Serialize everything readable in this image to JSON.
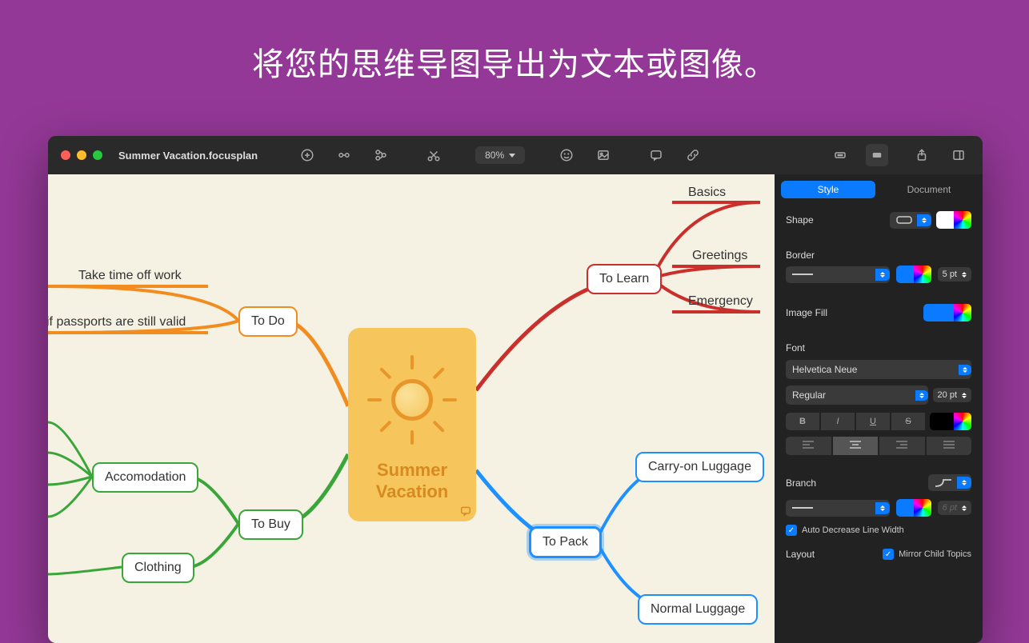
{
  "headline": "将您的思维导图导出为文本或图像。",
  "window": {
    "title": "Summer Vacation.focusplan",
    "zoom": "80%"
  },
  "mindmap": {
    "central": "Summer\nVacation",
    "nodes": {
      "todo": "To Do",
      "take_time_off": "Take time off work",
      "passports": "if passports are still valid",
      "tobuy": "To Buy",
      "accomodation": "Accomodation",
      "clothing": "Clothing",
      "tolearn": "To Learn",
      "basics": "Basics",
      "greetings": "Greetings",
      "emergency": "Emergency",
      "topack": "To Pack",
      "carryon": "Carry-on Luggage",
      "normal": "Normal Luggage"
    }
  },
  "sidebar": {
    "tabs": {
      "style": "Style",
      "document": "Document"
    },
    "shape_label": "Shape",
    "border_label": "Border",
    "border_width": "5 pt",
    "image_fill_label": "Image Fill",
    "font_label": "Font",
    "font_family": "Helvetica Neue",
    "font_weight": "Regular",
    "font_size": "20 pt",
    "style_bold": "B",
    "style_italic": "I",
    "style_underline": "U",
    "style_strike": "S",
    "branch_label": "Branch",
    "branch_width": "6 pt",
    "auto_decrease": "Auto Decrease Line Width",
    "layout_label": "Layout",
    "mirror_topics": "Mirror Child Topics"
  },
  "colors": {
    "orange": "#f28c1e",
    "green": "#3aa63a",
    "red": "#c9302c",
    "blue": "#1e90ff",
    "accent": "#0a7aff"
  }
}
